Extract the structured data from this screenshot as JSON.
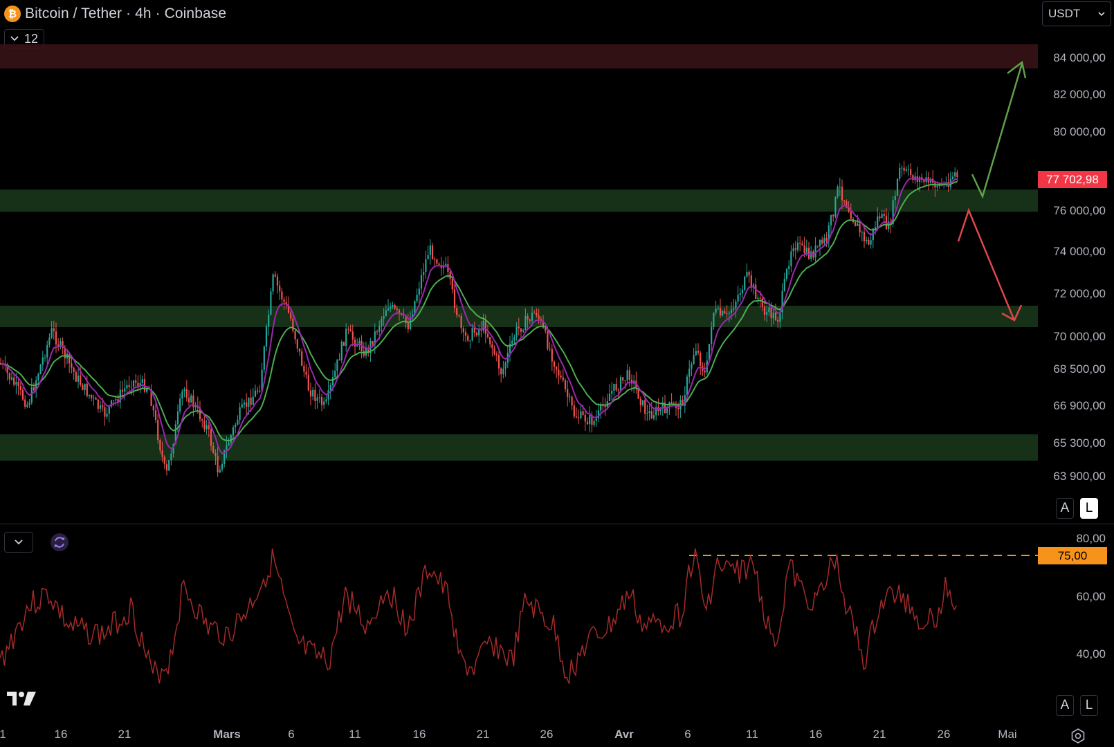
{
  "header": {
    "title": "Bitcoin / Tether · 4h · Coinbase",
    "coin_symbol": "₿",
    "indicator_count": "12",
    "currency": "USDT"
  },
  "price_axis": {
    "labels": [
      "84 000,00",
      "82 000,00",
      "80 000,00",
      "76 000,00",
      "74 000,00",
      "72 000,00",
      "70 000,00",
      "68 500,00",
      "66 900,00",
      "65 300,00",
      "63 900,00"
    ],
    "current_price": "77 702,98",
    "current_price_color": "#f23645"
  },
  "rsi_axis": {
    "labels": [
      "80,00",
      "60,00",
      "40,00"
    ],
    "level": "75,00",
    "level_color": "#f7931a"
  },
  "buttons": {
    "auto": "A",
    "log": "L"
  },
  "time_axis": {
    "labels": [
      "1",
      "16",
      "21",
      "Mars",
      "6",
      "11",
      "16",
      "21",
      "26",
      "Avr",
      "6",
      "11",
      "16",
      "21",
      "26",
      "Mai"
    ]
  },
  "colors": {
    "up_candle": "#26a69a",
    "down_candle": "#ef5350",
    "ma_fast": "#9c27b0",
    "ma_slow": "#4caf50",
    "resistance_zone": "#3a1418",
    "support_zone": "#1b3a1c",
    "rsi_line": "#a52a2a",
    "arrow_up": "#5fa14a",
    "arrow_down": "#e0474c"
  },
  "icons": {
    "chevron": "chevron-down-icon",
    "refresh": "refresh-icon",
    "settings": "settings-icon",
    "logo": "tradingview-logo"
  }
}
